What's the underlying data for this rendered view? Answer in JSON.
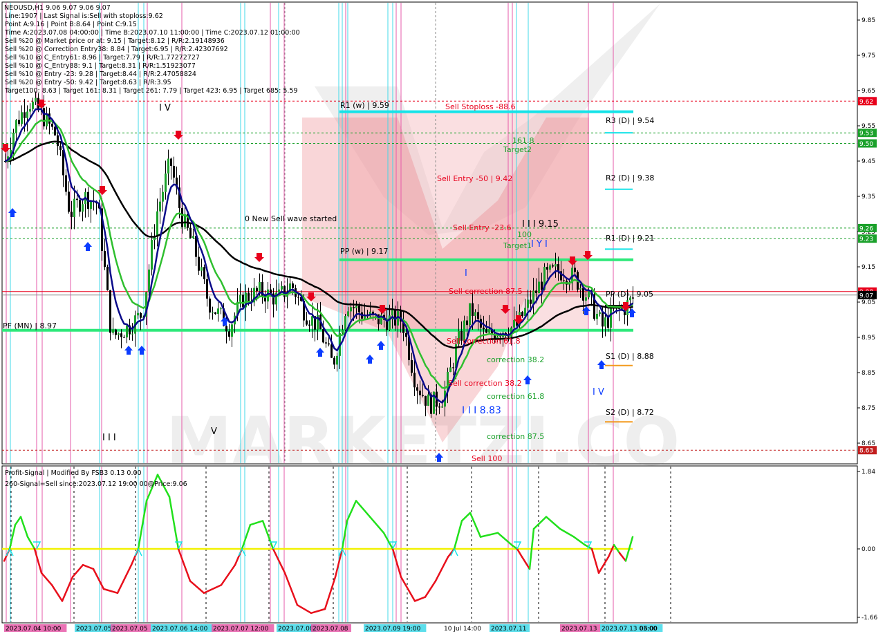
{
  "header": {
    "symbol_line": "NEOUSD,H1  9.06 9.07 9.06 9.07",
    "info_lines": [
      "Line:1907  | Last Signal is:Sell with stoploss:9.62",
      "Point A:9.16 | Point B:8.64 | Point C:9.15",
      "Time A:2023.07.08 04:00:00 | Time B:2023.07.10 11:00:00 | Time C:2023.07.12 01:00:00",
      "Sell %20 @ Market price or at: 9.15 | Target:8.12 | R/R:2.19148936",
      "Sell %20 @ Correction Entry38: 8.84 | Target:6.95 | R/R:2.42307692",
      "Sell %10 @ C_Entry61: 8.96 | Target:7.79 | R/R:1.77272727",
      "Sell %10 @ C_Entry88: 9.1 | Target:8.31 | R/R:1.51923077",
      "Sell %10 @ Entry -23: 9.28 | Target:8.44 | R/R:2.47058824",
      "Sell %20 @ Entry -50: 9.42 | Target:8.63 | R/R:3.95",
      "Target100: 8.63 | Target 161: 8.31 | Target 261: 7.79 | Target 423: 6.95 | Target 685: 5.59"
    ]
  },
  "price_axis": {
    "ticks": [
      "9.85",
      "9.75",
      "9.65",
      "9.55",
      "9.45",
      "9.35",
      "9.25",
      "9.15",
      "9.05",
      "8.95",
      "8.85",
      "8.75",
      "8.65"
    ],
    "badges": [
      {
        "text": "9.62",
        "color": "#e8001c"
      },
      {
        "text": "9.53",
        "color": "#1ba12b"
      },
      {
        "text": "9.50",
        "color": "#1ba12b"
      },
      {
        "text": "9.26",
        "color": "#1ba12b"
      },
      {
        "text": "9.23",
        "color": "#1ba12b"
      },
      {
        "text": "9.08",
        "color": "#e8001c"
      },
      {
        "text": "9.07",
        "color": "#000000"
      },
      {
        "text": "8.63",
        "color": "#c21e1e"
      }
    ]
  },
  "annotations": {
    "r1w": "R1 (w) | 9.59",
    "sell_stoploss": "Sell Stoploss -88.6",
    "r3d": "R3 (D) | 9.54",
    "t161": "161.8",
    "target2": "Target2",
    "sell_entry_50": "Sell Entry -50 | 9.42",
    "r2d": "R2 (D) | 9.38",
    "new_sell_wave": "0 New Sell wave started",
    "sell_entry_236": "Sell Entry -23.6",
    "iii_915": "I I I 9.15",
    "t100": "100",
    "target1": "Target1",
    "r1d": "R1 (D) | 9.21",
    "pp_w": "PP (w) | 9.17",
    "sell_corr_875": "Sell correction 87.5",
    "pp_d": "PP (D) | 9.05",
    "pf_mn": "PF (MN) | 8.97",
    "sell_corr_618": "Sell correction 61.8",
    "corr_382_a": "correction 38.2",
    "s1d": "S1 (D) | 8.88",
    "sell_corr_382": "Sell correction 38.2",
    "iii_883": "I I I 8.83",
    "corr_618": "correction 61.8",
    "s2d": "S2 (D) | 8.72",
    "corr_875": "correction 87.5",
    "sell_100": "Sell 100",
    "wave_iv_top": "I V",
    "wave_iv_r": "I V",
    "wave_v": "V",
    "wave_iii": "I I I",
    "wave_i": "I",
    "wave_y": "I Y I"
  },
  "indicator": {
    "title": "Profit-Signal | Modified By FSB3 0.13 0.00",
    "signal_line": "260-Signal=Sell since:2023.07.12 19:00 00@Price:9.06",
    "axis": [
      "1.84",
      "0.00",
      "-1.66"
    ]
  },
  "time_axis": {
    "labels": [
      "2023.07.04 10:00",
      "2023.07.05",
      "2023.07.05",
      "2023.07.06 14:00",
      "2023.07.07 12:00",
      "2023.07.08",
      "2023.07.08",
      "2023.07.09 19:00",
      "10 Jul 14:00",
      "2023.07.11",
      "2023.07.13",
      "2023.07.13 03:00",
      "06:00"
    ]
  },
  "colors": {
    "bull_candle": "#1ba12b",
    "bear_candle": "#000000",
    "ma_black": "#000000",
    "ma_blue": "#0a0a8a",
    "ma_green": "#2fbf2f",
    "pivot_cyan": "#15e3e8",
    "pivot_green": "#2ee87a",
    "sell_red": "#e8001c",
    "buy_blue": "#0b3cff",
    "vline_magenta": "#e65aa8",
    "vline_cyan": "#40d8e8",
    "osc_green": "#22e01c",
    "osc_red": "#e8101c",
    "zero_yellow": "#f2f200"
  },
  "chart_data": {
    "type": "candlestick",
    "symbol": "NEOUSD",
    "timeframe": "H1",
    "ylim": [
      8.6,
      9.9
    ],
    "levels": {
      "sell_stoploss": 9.62,
      "r1w": 9.59,
      "r3d": 9.54,
      "target2": 9.53,
      "r2d": 9.38,
      "r1d": 9.21,
      "pp_w": 9.17,
      "pp_d": 9.05,
      "pf_mn": 8.97,
      "s1d": 8.88,
      "s2d": 8.72,
      "sell_100": 8.63,
      "current": 9.07
    },
    "osc_range": [
      -1.66,
      1.84
    ]
  }
}
